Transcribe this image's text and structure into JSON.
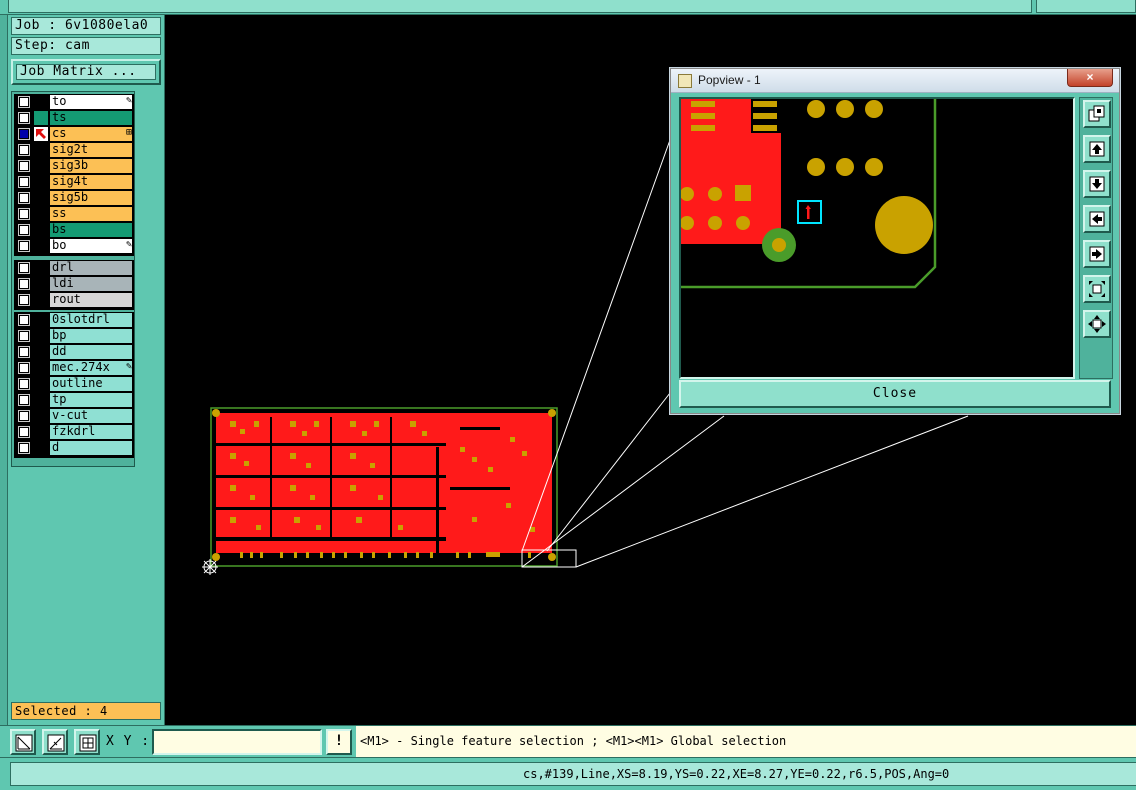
{
  "job": {
    "job_label": "Job : 6v1080ela0",
    "step_label": "Step: cam",
    "job_matrix_button": "Job Matrix ..."
  },
  "layers_group1": [
    {
      "name": "to",
      "color": "#ffffff",
      "checked": false,
      "sym": "pencil"
    },
    {
      "name": "ts",
      "color": "#149a73",
      "checked": false,
      "sym": ""
    },
    {
      "name": "cs",
      "color": "#fcc055",
      "checked": true,
      "sym": "plus-box"
    },
    {
      "name": "sig2t",
      "color": "#fcc055",
      "checked": false,
      "sym": ""
    },
    {
      "name": "sig3b",
      "color": "#fcc055",
      "checked": false,
      "sym": ""
    },
    {
      "name": "sig4t",
      "color": "#fcc055",
      "checked": false,
      "sym": ""
    },
    {
      "name": "sig5b",
      "color": "#fcc055",
      "checked": false,
      "sym": ""
    },
    {
      "name": "ss",
      "color": "#fcc055",
      "checked": false,
      "sym": ""
    },
    {
      "name": "bs",
      "color": "#149a73",
      "checked": false,
      "sym": ""
    },
    {
      "name": "bo",
      "color": "#ffffff",
      "checked": false,
      "sym": "pencil"
    }
  ],
  "layers_group2": [
    {
      "name": "drl",
      "color": "#a8b4b8"
    },
    {
      "name": "ldi",
      "color": "#a8b4b8"
    },
    {
      "name": "rout",
      "color": "#d6d6d6"
    }
  ],
  "layers_group3": [
    {
      "name": "0slotdrl",
      "color": "#8fe0d3",
      "sym": ""
    },
    {
      "name": "bp",
      "color": "#8fe0d3",
      "sym": ""
    },
    {
      "name": "dd",
      "color": "#8fe0d3",
      "sym": ""
    },
    {
      "name": "mec.274x",
      "color": "#8fe0d3",
      "sym": "pencil"
    },
    {
      "name": "outline",
      "color": "#8fe0d3",
      "sym": ""
    },
    {
      "name": "tp",
      "color": "#8fe0d3",
      "sym": ""
    },
    {
      "name": "v-cut",
      "color": "#8fe0d3",
      "sym": ""
    },
    {
      "name": "fzkdrl",
      "color": "#8fe0d3",
      "sym": ""
    },
    {
      "name": "d",
      "color": "#8fe0d3",
      "sym": ""
    }
  ],
  "selected_label": "Selected : 4",
  "bottom": {
    "xy_label": "X Y :",
    "xy_value": "",
    "bang": "!",
    "hint": "<M1> - Single feature selection ; <M1><M1> Global selection"
  },
  "status": {
    "text": "cs,#139,Line,XS=8.19,YS=0.22,XE=8.27,YE=0.22,r6.5,POS,Ang=0"
  },
  "popview": {
    "title": "Popview - 1",
    "close_x": "×",
    "close_button": "Close"
  },
  "colors": {
    "panel": "#5fc7b0",
    "copper": "#ff1a1a",
    "pad": "#c9a200",
    "outline": "#4a9c2a",
    "highlight": "#00e5ff"
  }
}
